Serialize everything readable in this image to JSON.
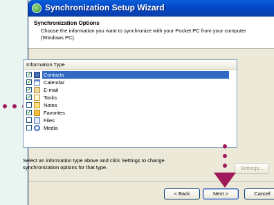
{
  "window": {
    "title": "Synchronization Setup Wizard"
  },
  "header": {
    "title": "Synchronization Options",
    "description": "Choose the information you want to synchronize with your Pocket PC from your computer (Windows PC)."
  },
  "list": {
    "column_header": "Information Type",
    "items": [
      {
        "label": "Contacts",
        "checked": true,
        "selected": true,
        "icon": "contacts-icon"
      },
      {
        "label": "Calendar",
        "checked": true,
        "selected": false,
        "icon": "calendar-icon"
      },
      {
        "label": "E-mail",
        "checked": true,
        "selected": false,
        "icon": "email-icon"
      },
      {
        "label": "Tasks",
        "checked": true,
        "selected": false,
        "icon": "tasks-icon"
      },
      {
        "label": "Notes",
        "checked": false,
        "selected": false,
        "icon": "notes-icon"
      },
      {
        "label": "Favorites",
        "checked": true,
        "selected": false,
        "icon": "favorites-icon"
      },
      {
        "label": "Files",
        "checked": false,
        "selected": false,
        "icon": "files-icon"
      },
      {
        "label": "Media",
        "checked": false,
        "selected": false,
        "icon": "media-icon"
      }
    ]
  },
  "hint": "Select an information type above and click Settings to change synchronization options for that type.",
  "buttons": {
    "settings": "Settings...",
    "back": "< Back",
    "next": "Next >",
    "cancel": "Cancel"
  },
  "colors": {
    "annotation": "#a0195a",
    "selection": "#316ac5",
    "title_bar": "#0347c7"
  }
}
